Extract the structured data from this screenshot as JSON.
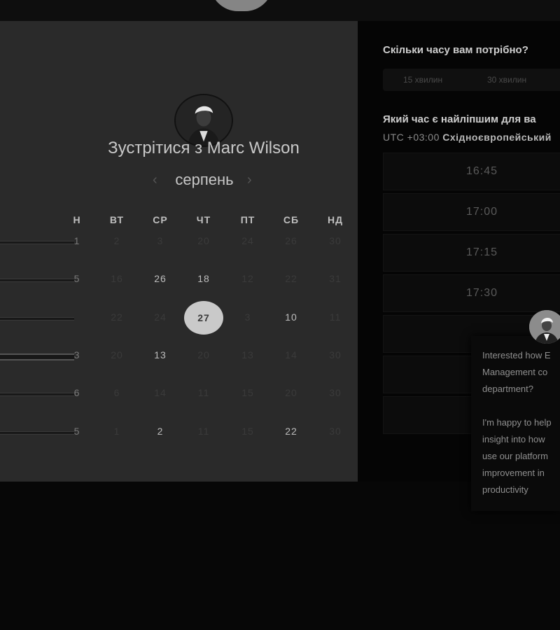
{
  "meeting": {
    "title": "Зустрітися з Marc Wilson"
  },
  "calendar": {
    "month": "серпень",
    "prev_icon": "chevron-left-icon",
    "next_icon": "chevron-right-icon",
    "weekdays": [
      "Н",
      "ВТ",
      "СР",
      "ЧТ",
      "ПТ",
      "СБ",
      "НД"
    ],
    "weeks": [
      [
        "1",
        "2",
        "3",
        "20",
        "24",
        "26",
        "30"
      ],
      [
        "5",
        "16",
        "26",
        "18",
        "12",
        "22",
        "31"
      ],
      [
        "",
        "22",
        "24",
        "27",
        "3",
        "10",
        "11"
      ],
      [
        "3",
        "20",
        "13",
        "20",
        "13",
        "14",
        "30"
      ],
      [
        "6",
        "6",
        "14",
        "11",
        "15",
        "20",
        "30"
      ],
      [
        "5",
        "1",
        "2",
        "11",
        "15",
        "22",
        "30"
      ]
    ],
    "available": [
      [
        2,
        1
      ],
      [
        2,
        3
      ],
      [
        3,
        5
      ],
      [
        4,
        2
      ],
      [
        6,
        2
      ],
      [
        6,
        5
      ]
    ],
    "selected_day": "27"
  },
  "duration": {
    "question": "Скільки часу вам потрібно?",
    "options": [
      "15 хвилин",
      "30 хвилин"
    ]
  },
  "time": {
    "question": "Який час є найліпшим для ва",
    "timezone_prefix": "UTC +03:00",
    "timezone_name": "Східноєвропейський",
    "slots": [
      "16:45",
      "17:00",
      "17:15",
      "17:30",
      "",
      "",
      ""
    ]
  },
  "chat": {
    "message": "Interested how E\nManagement co\ndepartment?\n\nI'm happy to help\ninsight into how\nuse our platform\nimprovement in\nproductivity"
  }
}
